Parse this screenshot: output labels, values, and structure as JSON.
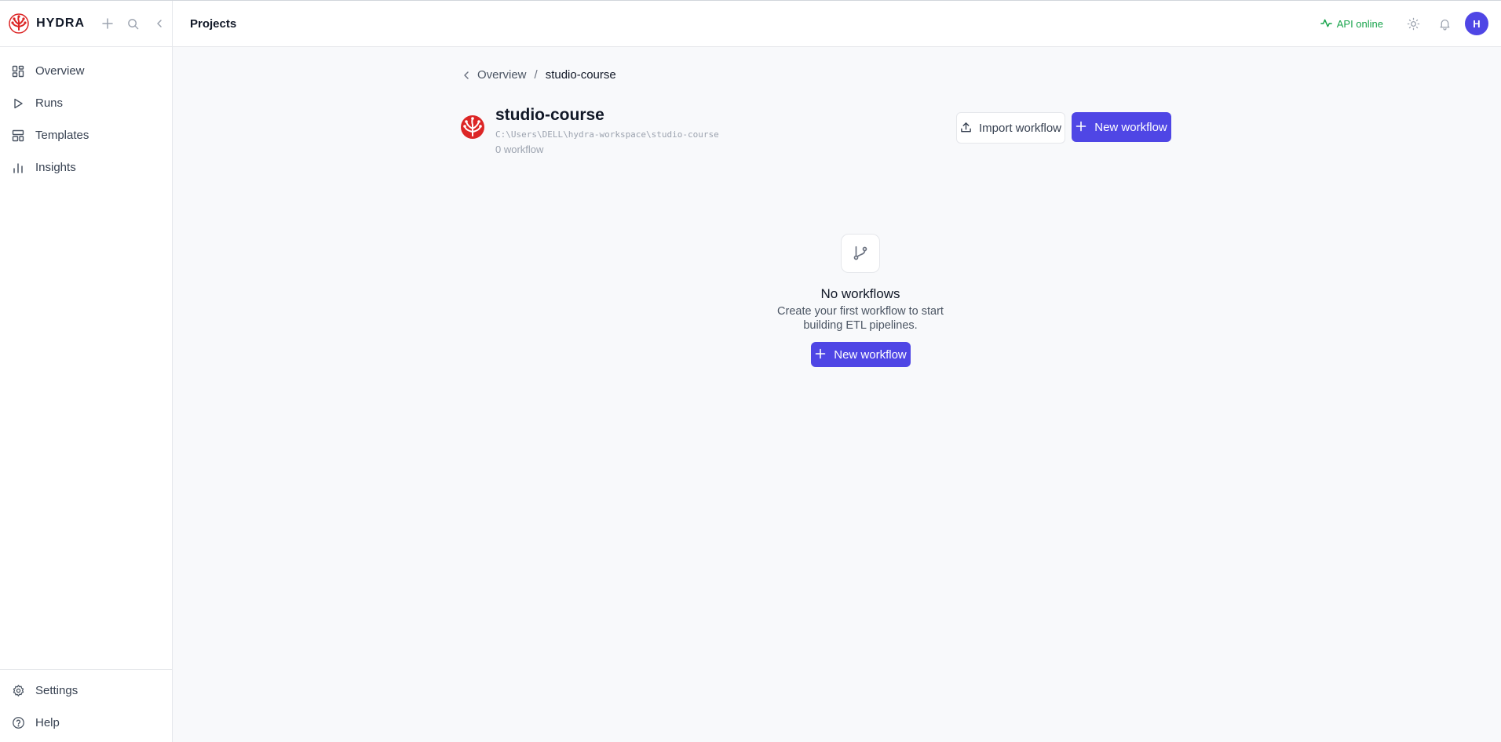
{
  "app": {
    "name": "HYDRA"
  },
  "header": {
    "title": "Projects",
    "api_status": "API online",
    "avatar_initial": "H"
  },
  "sidebar": {
    "items": [
      {
        "label": "Overview",
        "icon": "layout-dashboard-icon"
      },
      {
        "label": "Runs",
        "icon": "play-icon"
      },
      {
        "label": "Templates",
        "icon": "layout-template-icon"
      },
      {
        "label": "Insights",
        "icon": "bar-chart-icon"
      }
    ],
    "bottom_items": [
      {
        "label": "Settings",
        "icon": "gear-icon"
      },
      {
        "label": "Help",
        "icon": "help-circle-icon"
      }
    ]
  },
  "breadcrumb": {
    "parent": "Overview",
    "separator": "/",
    "current": "studio-course"
  },
  "project": {
    "name": "studio-course",
    "path": "C:\\Users\\DELL\\hydra-workspace\\studio-course",
    "count": "0 workflow"
  },
  "actions": {
    "import_label": "Import workflow",
    "new_label": "New workflow"
  },
  "empty_state": {
    "title": "No workflows",
    "description": "Create your first workflow to start building ETL pipelines.",
    "button_label": "New workflow"
  },
  "colors": {
    "primary": "#4f46e5",
    "success": "#16a34a",
    "brand_red": "#dc2626"
  }
}
